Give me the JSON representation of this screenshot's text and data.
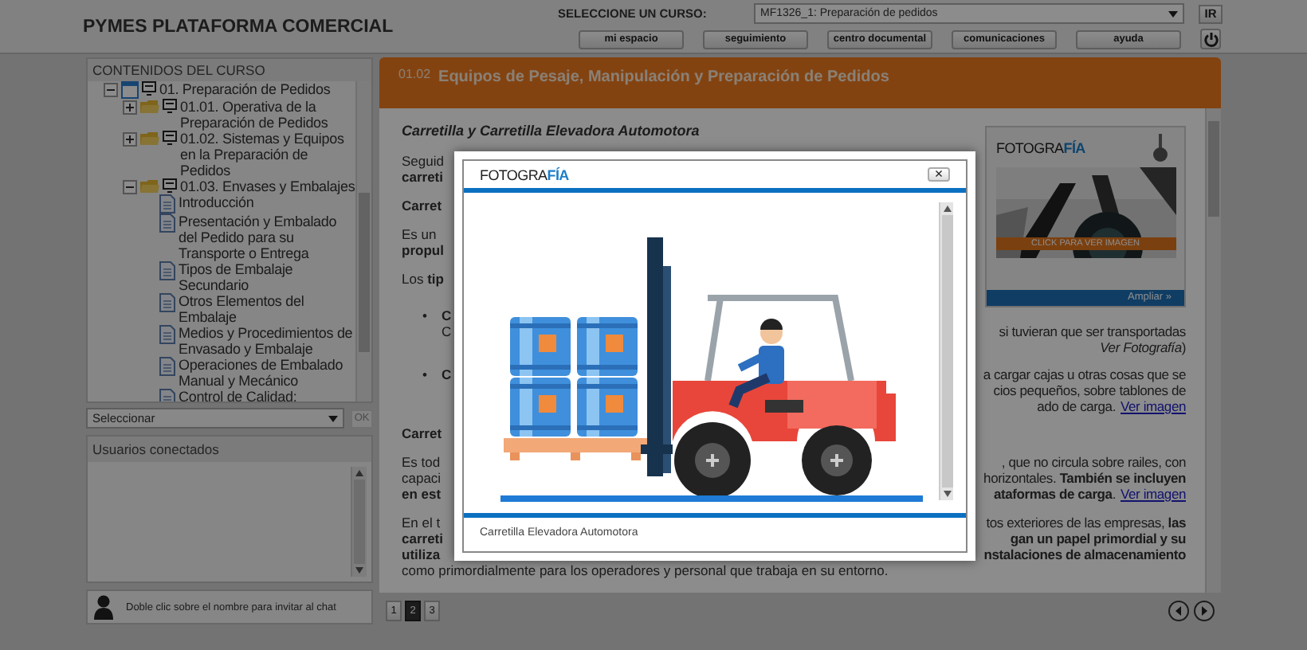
{
  "app_title": "PYMES PLATAFORMA COMERCIAL",
  "course_selector": {
    "label": "SELECCIONE UN CURSO:",
    "value": "MF1326_1: Preparación de pedidos",
    "go_button": "IR"
  },
  "nav_buttons": [
    "mi espacio",
    "seguimiento",
    "centro documental",
    "comunicaciones",
    "ayuda"
  ],
  "sidebar": {
    "contents_title": "CONTENIDOS DEL CURSO",
    "tree": [
      {
        "label": "01. Preparación de Pedidos",
        "kind": "module",
        "expanded": true,
        "children": [
          {
            "label": "01.01. Operativa de la Preparación de Pedidos",
            "kind": "folder",
            "expanded": false
          },
          {
            "label": "01.02. Sistemas y Equipos en la Preparación de Pedidos",
            "kind": "folder",
            "expanded": false
          },
          {
            "label": "01.03. Envases y Embalajes",
            "kind": "folder",
            "expanded": true,
            "children": [
              {
                "label": "Introducción",
                "kind": "page"
              },
              {
                "label": "Presentación y Embalado del Pedido para su Transporte o Entrega",
                "kind": "page"
              },
              {
                "label": "Tipos de Embalaje Secundario",
                "kind": "page"
              },
              {
                "label": "Otros Elementos del Embalaje",
                "kind": "page"
              },
              {
                "label": "Medios y Procedimientos de Envasado y Embalaje",
                "kind": "page"
              },
              {
                "label": "Operaciones de Embalado Manual y Mecánico",
                "kind": "page"
              },
              {
                "label": "Control de Calidad:",
                "kind": "page"
              }
            ]
          }
        ]
      }
    ],
    "select": {
      "value": "Seleccionar",
      "button": "OK",
      "disabled": true
    },
    "users": {
      "title": "Usuarios conectados",
      "hint": "Doble clic sobre el nombre para invitar al chat"
    }
  },
  "lesson": {
    "number": "01.02",
    "title": "Equipos de Pesaje, Manipulación y Preparación de Pedidos",
    "top_paragraphs": [
      {
        "kind": "heading",
        "lines": [
          {
            "left": "Carretilla y Carretilla Elevadora Automotora"
          }
        ]
      },
      {
        "kind": "text",
        "lines": [
          {
            "left": "Seguid"
          },
          {
            "left": "**carreti**"
          }
        ]
      },
      {
        "kind": "subheading",
        "lines": [
          {
            "left": "Carret"
          }
        ]
      },
      {
        "kind": "text",
        "lines": [
          {
            "left": "Es un"
          },
          {
            "left": "**propul**"
          }
        ]
      },
      {
        "kind": "text",
        "lines": [
          {
            "left": "Los **tip**"
          }
        ]
      }
    ],
    "photo_card": {
      "logo": "FOTOGRA**FÍA**",
      "banner": "CLICK PARA VER IMAGEN",
      "action": "Ampliar »"
    },
    "paragraphs": [
      {
        "kind": "bullet",
        "bullet": "•",
        "lines": [
          {
            "left": "**C**"
          },
          {
            "left": "C",
            "right": "si tuvieran que ser transportadas"
          },
          {
            "right": "*Ver Fotografía*)"
          }
        ]
      },
      {
        "kind": "bullet",
        "bullet": "•",
        "lines": [
          {
            "left": "**C**",
            "right": "a cargar cajas u otras cosas que se"
          },
          {
            "right": "cios pequeños, sobre tablones de"
          },
          {
            "right": "ado de carga.",
            "link": "Ver imagen"
          }
        ]
      },
      {
        "kind": "subheading",
        "lines": [
          {
            "left": "Carret"
          }
        ]
      },
      {
        "kind": "text",
        "lines": [
          {
            "left": "Es tod",
            "right": ", que no circula sobre railes, con"
          },
          {
            "left": "capaci",
            "right": "horizontales. **También se incluyen**"
          },
          {
            "left": "**en est**",
            "right": "**ataformas de carga**.",
            "link": "Ver imagen"
          }
        ]
      },
      {
        "kind": "text",
        "lines": [
          {
            "left": "En el t",
            "right": "tos exteriores de las empresas, **las**"
          },
          {
            "left": "**carreti**",
            "right": "**gan un papel primordial y su**"
          },
          {
            "left": "**utiliza**",
            "right": "**nstalaciones de almacenamiento**"
          },
          {
            "left": "como primordialmente para los operadores y personal que trabaja en su entorno."
          }
        ]
      }
    ]
  },
  "pages": [
    {
      "label": "1",
      "selected": false
    },
    {
      "label": "2",
      "selected": true
    },
    {
      "label": "3",
      "selected": false
    }
  ],
  "modal": {
    "logo": "FOTOGRA**FÍA**",
    "close": "×",
    "caption": "Carretilla Elevadora Automotora"
  }
}
